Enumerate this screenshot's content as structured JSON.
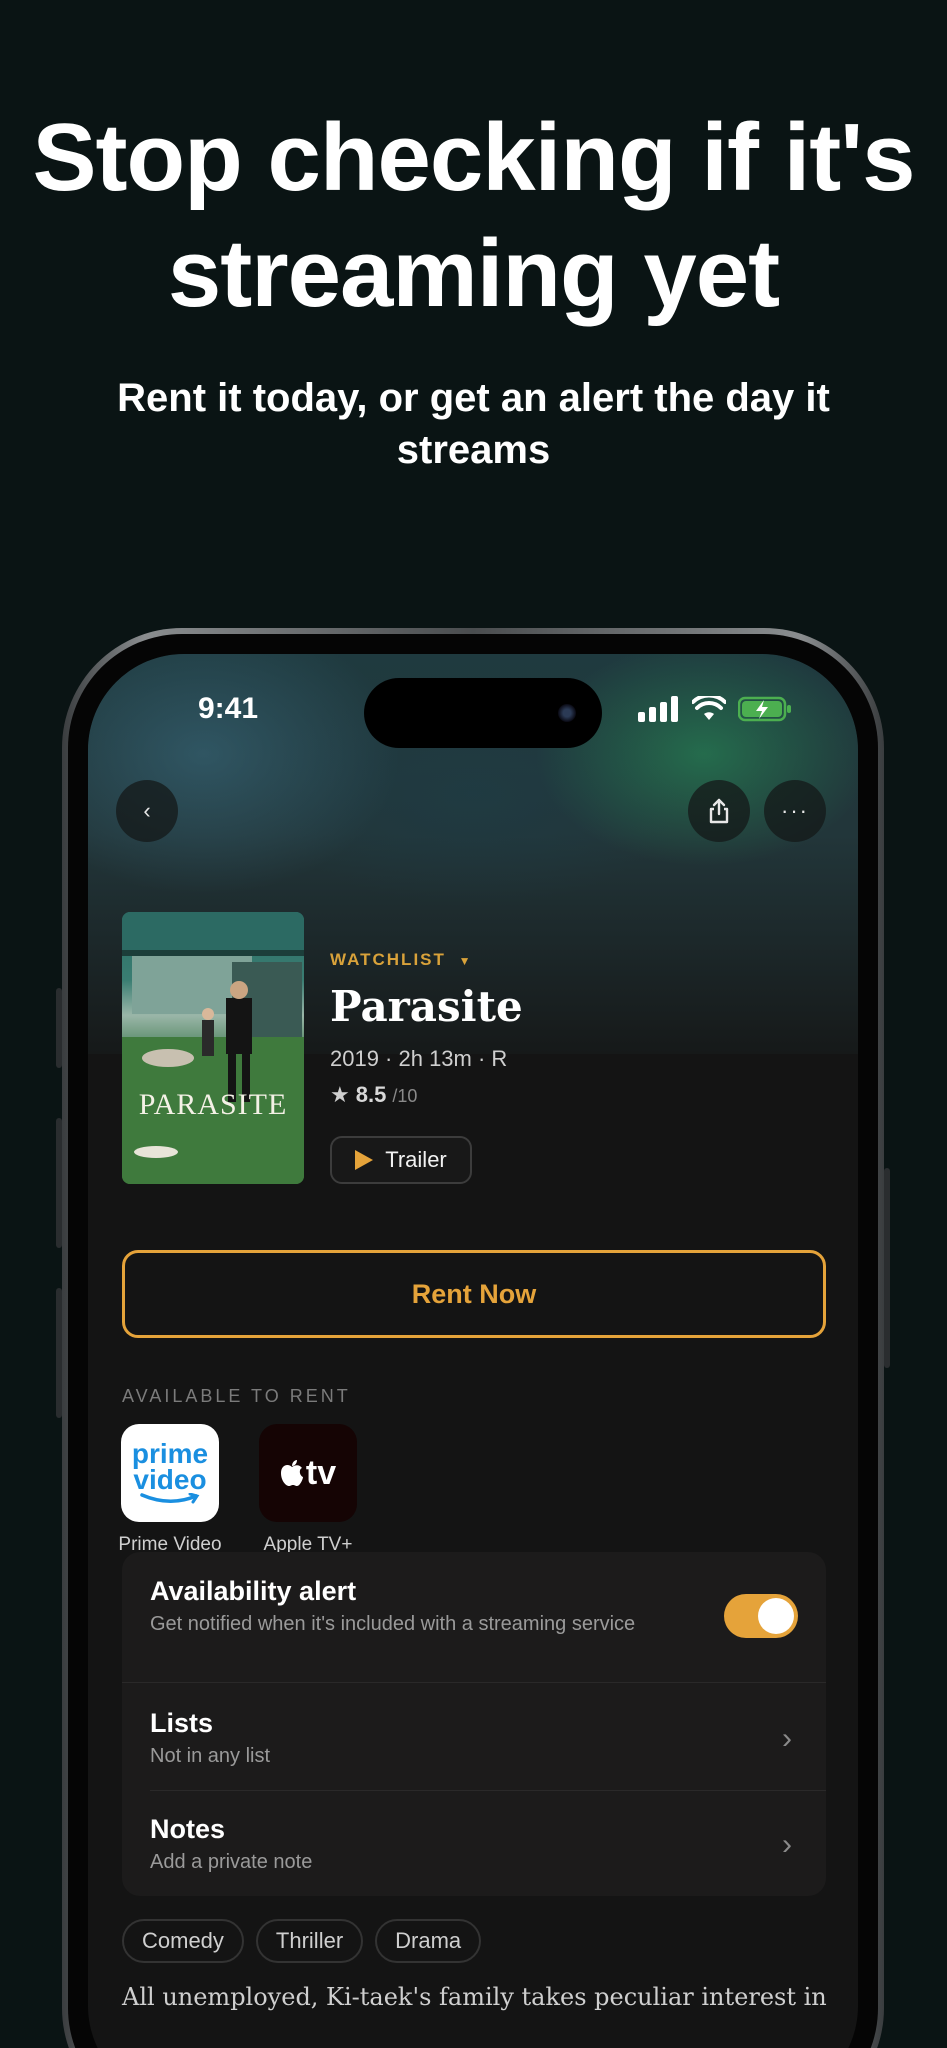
{
  "promo": {
    "headline": "Stop checking if it's streaming yet",
    "subheadline": "Rent it today, or get an alert the day it streams"
  },
  "status_bar": {
    "time": "9:41"
  },
  "movie": {
    "watchlist_label": "WATCHLIST",
    "title": "Parasite",
    "poster_title": "PARASITE",
    "meta": "2019 · 2h 13m · R",
    "rating": "8.5",
    "rating_max": "/10",
    "trailer_label": "Trailer"
  },
  "rent": {
    "button_label": "Rent Now",
    "section_label": "AVAILABLE TO RENT",
    "providers": [
      {
        "name": "Prime Video",
        "logo_line1": "prime",
        "logo_line2": "video",
        "icon": "prime-video-icon"
      },
      {
        "name": "Apple TV+",
        "logo_text": "tv",
        "icon": "apple-tv-icon"
      }
    ]
  },
  "settings": {
    "alert_title": "Availability alert",
    "alert_sub": "Get notified when it's included with a streaming service",
    "alert_enabled": true,
    "lists_title": "Lists",
    "lists_sub": "Not in any list",
    "notes_title": "Notes",
    "notes_sub": "Add a private note"
  },
  "genres": [
    "Comedy",
    "Thriller",
    "Drama"
  ],
  "synopsis": "All unemployed, Ki-taek's family takes peculiar interest in",
  "colors": {
    "accent": "#e5a33a",
    "background": "#0a1414"
  }
}
